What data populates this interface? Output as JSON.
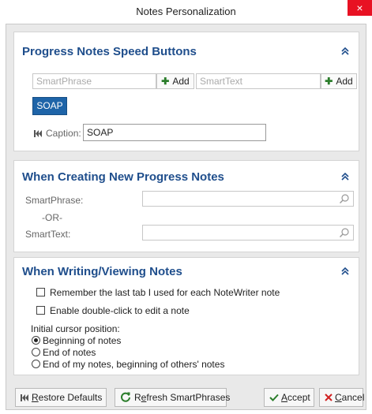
{
  "window": {
    "title": "Notes Personalization",
    "close_glyph": "×"
  },
  "speed_buttons": {
    "title": "Progress Notes Speed Buttons",
    "smartphrase_placeholder": "SmartPhrase",
    "smarttext_placeholder": "SmartText",
    "add_label": "Add",
    "soap_button": "SOAP",
    "caption_label": "Caption:",
    "caption_value": "SOAP"
  },
  "creating_new": {
    "title": "When Creating New Progress Notes",
    "smartphrase_label": "SmartPhrase:",
    "or_label": "-OR-",
    "smarttext_label": "SmartText:"
  },
  "writing_viewing": {
    "title": "When Writing/Viewing Notes",
    "checkbox_remember": "Remember the last tab I used for each NoteWriter note",
    "checkbox_doubleclick": "Enable double-click to edit a note",
    "cursor_label": "Initial cursor position:",
    "radio_options": [
      "Beginning of notes",
      "End of notes",
      "End of my notes, beginning of others' notes"
    ],
    "radio_selected_index": 0
  },
  "footer": {
    "restore_first": "R",
    "restore_rest": "estore Defaults",
    "refresh_prefix": "R",
    "refresh_underlined": "e",
    "refresh_rest": "fresh SmartPhrases",
    "accept_first": "A",
    "accept_rest": "ccept",
    "cancel_first": "C",
    "cancel_rest": "ancel"
  },
  "colors": {
    "accent": "#1f4e8c",
    "button_blue": "#1e64a8",
    "close_red": "#e81123",
    "add_green": "#2b7d2b"
  },
  "icons": [
    "close-icon",
    "collapse-icon",
    "plus-icon",
    "skip-back-icon",
    "search-icon",
    "refresh-icon",
    "check-icon",
    "x-icon"
  ]
}
